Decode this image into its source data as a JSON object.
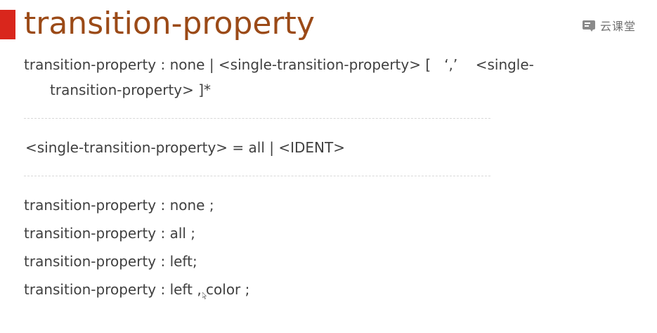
{
  "slide": {
    "title": "transition-property",
    "logo_text": "云课堂",
    "logo_icon": "cloud-classroom-icon"
  },
  "syntax": {
    "line1": "transition-property : none | <single-transition-property> [   ‘,’    <single-",
    "line2": "transition-property> ]*"
  },
  "definition": "<single-transition-property> = all | <IDENT>",
  "examples": [
    "transition-property : none ;",
    "transition-property : all ;",
    "transition-property : left;",
    "transition-property : left , color ;"
  ],
  "colors": {
    "accent": "#d9261c",
    "title": "#9b4a17",
    "text": "#404040",
    "divider": "#d8d8d8"
  }
}
